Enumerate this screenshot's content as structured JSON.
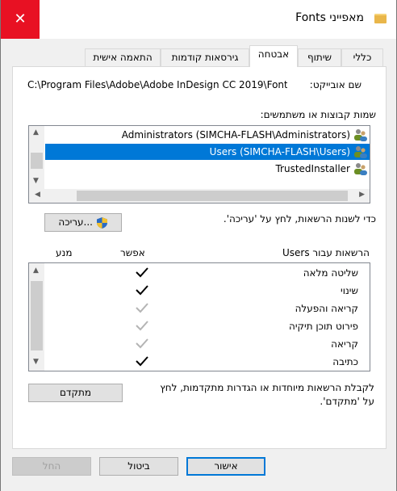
{
  "window": {
    "title": "מאפייני Fonts",
    "close_glyph": "✕"
  },
  "tabs": [
    {
      "label": "כללי"
    },
    {
      "label": "שיתוף"
    },
    {
      "label": "אבטחה"
    },
    {
      "label": "גירסאות קודמות"
    },
    {
      "label": "התאמה אישית"
    }
  ],
  "object": {
    "label": "שם אובייקט:",
    "value": "C:\\Program Files\\Adobe\\Adobe InDesign CC 2019\\Fonts"
  },
  "groups": {
    "label": "שמות קבוצות או משתמשים:",
    "items": [
      {
        "name": "Administrators (SIMCHA-FLASH\\Administrators)",
        "selected": false
      },
      {
        "name": "Users (SIMCHA-FLASH\\Users)",
        "selected": true
      },
      {
        "name": "TrustedInstaller",
        "selected": false
      }
    ]
  },
  "edit": {
    "hint": "כדי לשנות הרשאות, לחץ על 'עריכה'.",
    "button_label": "עריכה..."
  },
  "permissions": {
    "header": "הרשאות עבור Users",
    "allow_label": "אפשר",
    "deny_label": "מנע",
    "items": [
      {
        "name": "שליטה מלאה",
        "allow": true,
        "inherited": false
      },
      {
        "name": "שינוי",
        "allow": true,
        "inherited": false
      },
      {
        "name": "קריאה והפעלה",
        "allow": true,
        "inherited": true
      },
      {
        "name": "פירוט תוכן תיקיה",
        "allow": true,
        "inherited": true
      },
      {
        "name": "קריאה",
        "allow": true,
        "inherited": true
      },
      {
        "name": "כתיבה",
        "allow": true,
        "inherited": false
      }
    ]
  },
  "advanced": {
    "hint_line1": "לקבלת הרשאות מיוחדות או הגדרות מתקדמות, לחץ",
    "hint_line2": "על 'מתקדם'.",
    "button_label": "מתקדם"
  },
  "footer": {
    "ok_label": "אישור",
    "cancel_label": "ביטול",
    "apply_label": "החל"
  },
  "colors": {
    "accent": "#0078d7",
    "close": "#e81123",
    "check_active": "#000000",
    "check_inherited": "#b4b4b4"
  }
}
